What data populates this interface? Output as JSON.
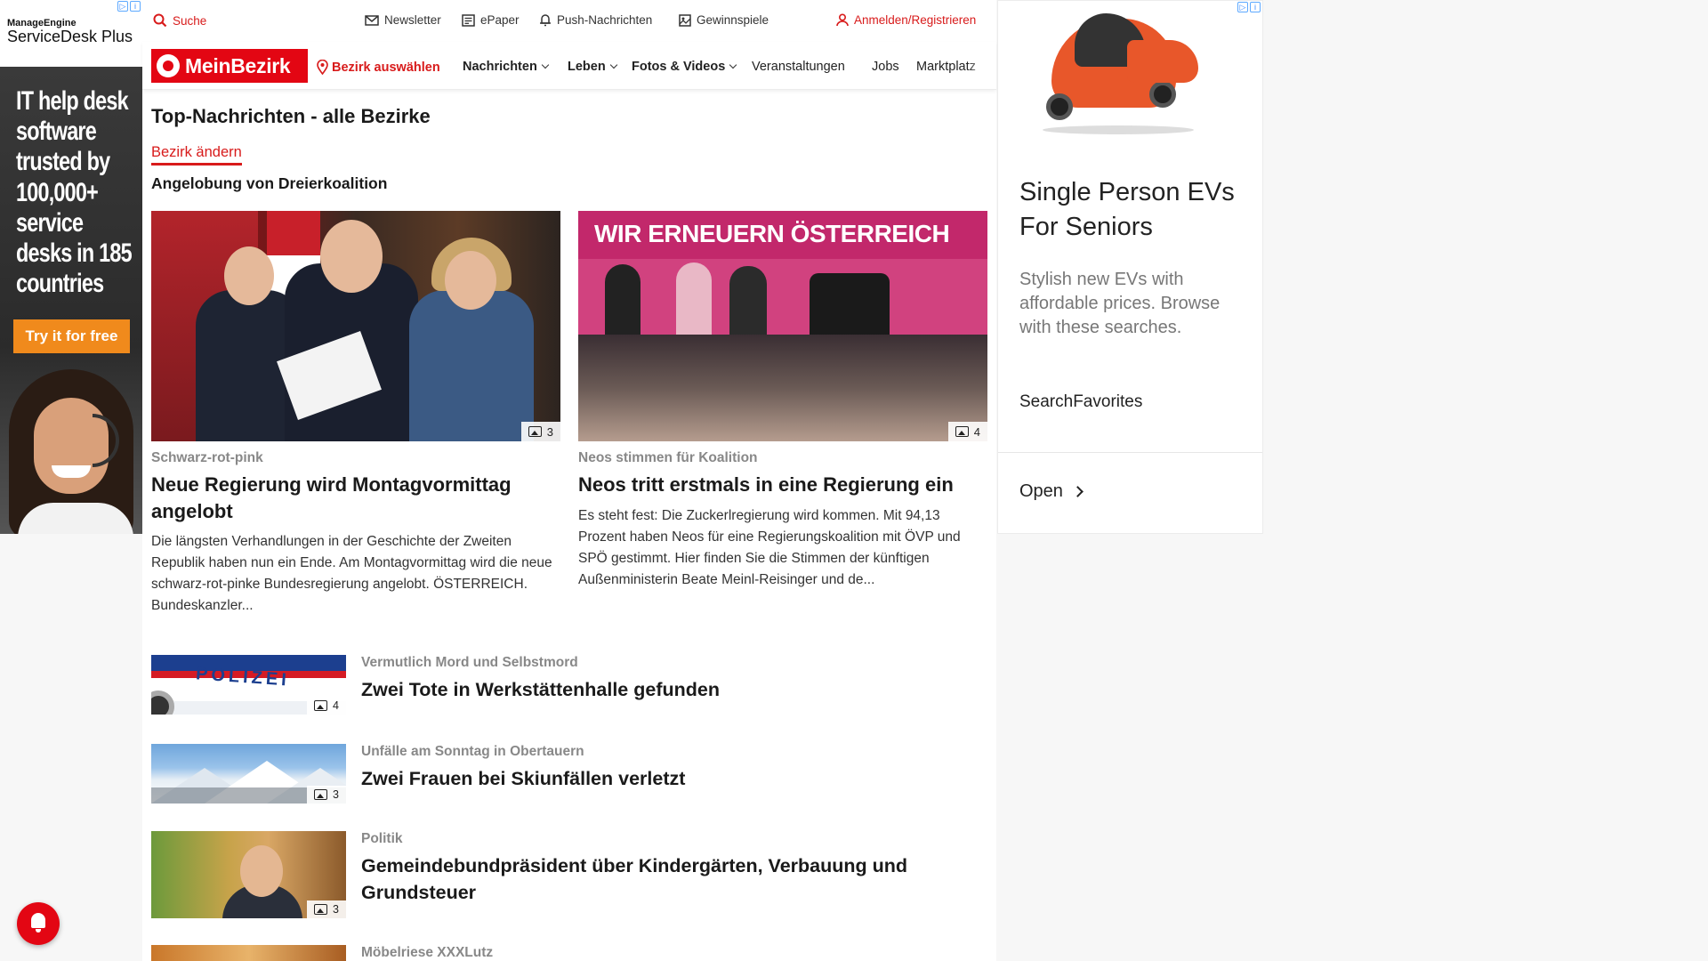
{
  "left_ad": {
    "brand_small": "ManageEngine",
    "brand_big": "ServiceDesk Plus",
    "headline": "IT help desk software trusted by 100,000+ service desks in 185 countries",
    "cta": "Try it for free"
  },
  "utility_bar": {
    "search": "Suche",
    "newsletter": "Newsletter",
    "epaper": "ePaper",
    "push": "Push-Nachrichten",
    "games": "Gewinnspiele",
    "login": "Anmelden/Registrieren"
  },
  "nav": {
    "logo": "MeinBezirk",
    "select_district": "Bezirk auswählen",
    "items": [
      "Nachrichten",
      "Leben",
      "Fotos & Videos",
      "Veranstaltungen",
      "Jobs",
      "Marktplatz"
    ]
  },
  "content": {
    "page_title": "Top-Nachrichten - alle Bezirke",
    "change_district": "Bezirk ändern",
    "section_title": "Angelobung von Dreierkoalition",
    "big_cards": [
      {
        "kicker": "Schwarz-rot-pink",
        "headline": "Neue Regierung wird Montagvormittag angelobt",
        "teaser": "Die längsten Verhandlungen in der Geschichte der Zweiten Republik haben nun ein Ende. Am Montagvormittag wird die neue schwarz-rot-pinke Bundesregierung angelobt. ÖSTERREICH. Bundeskanzler...",
        "image_count": "3"
      },
      {
        "kicker": "Neos stimmen für Koalition",
        "headline": "Neos tritt erstmals in eine Regierung ein",
        "teaser": "Es steht fest: Die Zuckerlregierung wird kommen. Mit 94,13 Prozent haben Neos für eine Regierungskoalition mit ÖVP und SPÖ gestimmt. Hier finden Sie die Stimmen der künftigen Außenministerin Beate Meinl-Reisinger und de...",
        "image_count": "4",
        "image_banner": "WIR ERNEUERN ÖSTERREICH"
      }
    ],
    "list_cards": [
      {
        "kicker": "Vermutlich Mord und Selbstmord",
        "headline": "Zwei Tote in Werkstättenhalle gefunden",
        "image_count": "4",
        "image_text": "POLIZEI"
      },
      {
        "kicker": "Unfälle am Sonntag in Obertauern",
        "headline": "Zwei Frauen bei Skiunfällen verletzt",
        "image_count": "3"
      },
      {
        "kicker": "Politik",
        "headline": "Gemeindebundpräsident über Kindergärten, Verbauung und Grundsteuer",
        "image_count": "3"
      },
      {
        "kicker": "Möbelriese XXXLutz",
        "headline": "",
        "image_count": ""
      }
    ]
  },
  "right_ad": {
    "title": "Single Person EVs For Seniors",
    "description": "Stylish new EVs with affordable prices. Browse with these searches.",
    "source": "SearchFavorites",
    "open": "Open"
  },
  "icons": {
    "search": "search-icon",
    "newsletter": "mail-icon",
    "epaper": "newspaper-icon",
    "push": "bell-icon",
    "games": "gift-icon",
    "login": "user-icon",
    "location": "map-pin-icon",
    "gallery": "gallery-icon",
    "adchoices": "adchoices-icon"
  },
  "colors": {
    "brand_red": "#e30613",
    "link_red": "#d81b1b",
    "ad_cta_orange": "#f08a1c"
  }
}
